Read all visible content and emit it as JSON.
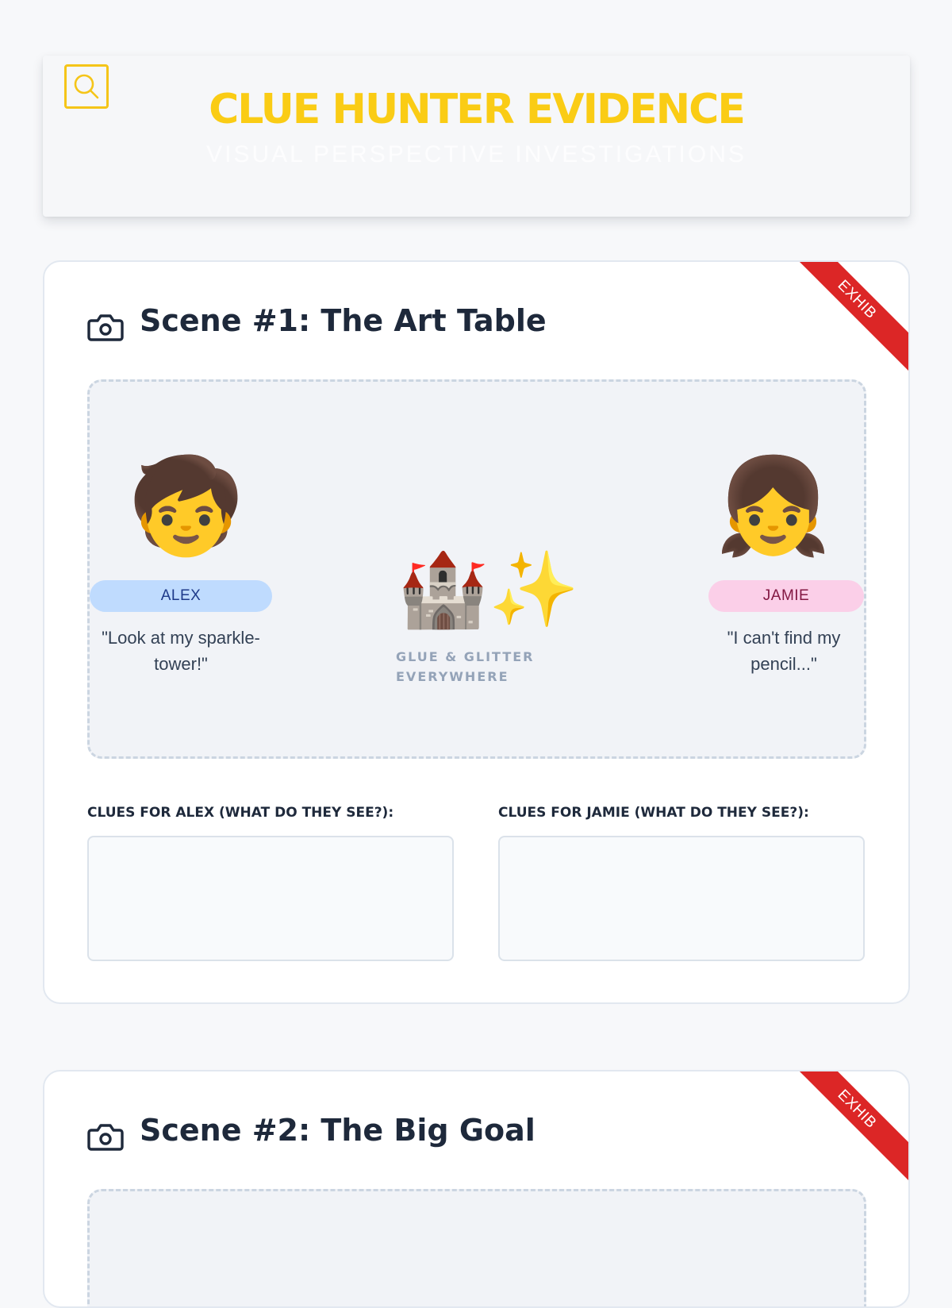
{
  "header": {
    "title": "CLUE HUNTER EVIDENCE",
    "subtitle": "VISUAL PERSPECTIVE INVESTIGATIONS",
    "icon": "search-icon",
    "accent": "#facc15"
  },
  "scenes": [
    {
      "title": "Scene #1: The Art Table",
      "ribbon": "EXHIB",
      "icon": "camera-icon",
      "left_kid": {
        "name": "ALEX",
        "quote": "\"Look at my sparkle-tower!\"",
        "emoji": "🧒"
      },
      "right_kid": {
        "name": "JAMIE",
        "quote": "\"I can't find my pencil...\"",
        "emoji": "👧"
      },
      "center": {
        "emoji": "🏰✨",
        "caption": "GLUE & GLITTER EVERYWHERE"
      },
      "clues_left_label": "CLUES FOR ALEX (WHAT DO THEY SEE?):",
      "clues_right_label": "CLUES FOR JAMIE (WHAT DO THEY SEE?):",
      "clues_left_value": "",
      "clues_right_value": ""
    },
    {
      "title": "Scene #2: The Big Goal",
      "ribbon": "EXHIB",
      "icon": "camera-icon"
    }
  ],
  "colors": {
    "ribbon": "#dc2626",
    "alex_tag": "#bfdbfe",
    "jamie_tag": "#fbcfe8"
  }
}
